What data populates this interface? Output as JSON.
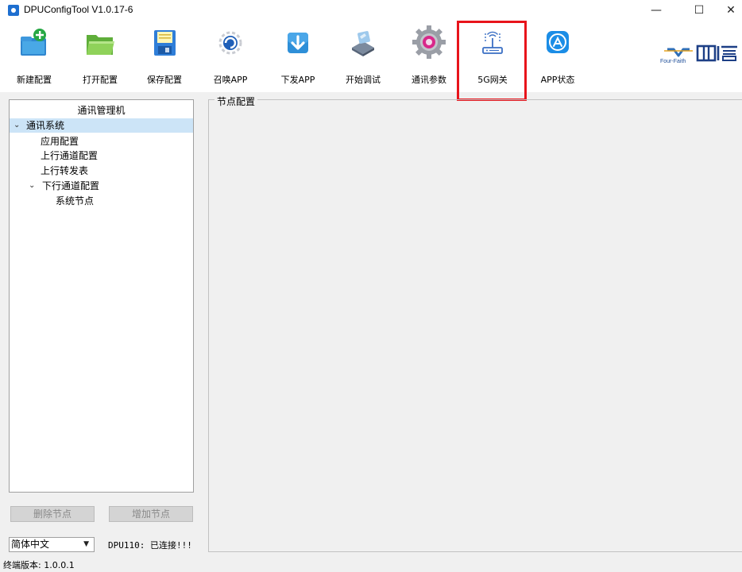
{
  "window": {
    "title": "DPUConfigTool V1.0.17-6",
    "minimize": "—",
    "maximize": "☐",
    "close": "✕"
  },
  "toolbar": {
    "items": [
      {
        "label": "新建配置",
        "icon": "new-config-icon"
      },
      {
        "label": "打开配置",
        "icon": "open-folder-icon"
      },
      {
        "label": "保存配置",
        "icon": "save-disk-icon"
      },
      {
        "label": "召唤APP",
        "icon": "summon-app-icon"
      },
      {
        "label": "下发APP",
        "icon": "download-app-icon"
      },
      {
        "label": "开始调试",
        "icon": "debug-icon"
      },
      {
        "label": "通讯参数",
        "icon": "gear-icon"
      },
      {
        "label": "5G网关",
        "icon": "router-icon"
      },
      {
        "label": "APP状态",
        "icon": "app-store-icon"
      }
    ],
    "highlight_color": "#e8141b"
  },
  "brand": {
    "name": "Four-Faith"
  },
  "tree": {
    "header": "通讯管理机",
    "nodes": [
      {
        "label": "通讯系统",
        "expanded": true,
        "selected": true
      },
      {
        "label": "应用配置"
      },
      {
        "label": "上行通道配置"
      },
      {
        "label": "上行转发表"
      },
      {
        "label": "下行通道配置",
        "expanded": true
      },
      {
        "label": "系统节点"
      }
    ]
  },
  "actions": {
    "delete_node": "删除节点",
    "add_node": "增加节点"
  },
  "language": {
    "selected": "简体中文"
  },
  "status": {
    "connection": "DPU110: 已连接!!!",
    "version": "终端版本: 1.0.0.1"
  },
  "node_config": {
    "title": "节点配置"
  }
}
